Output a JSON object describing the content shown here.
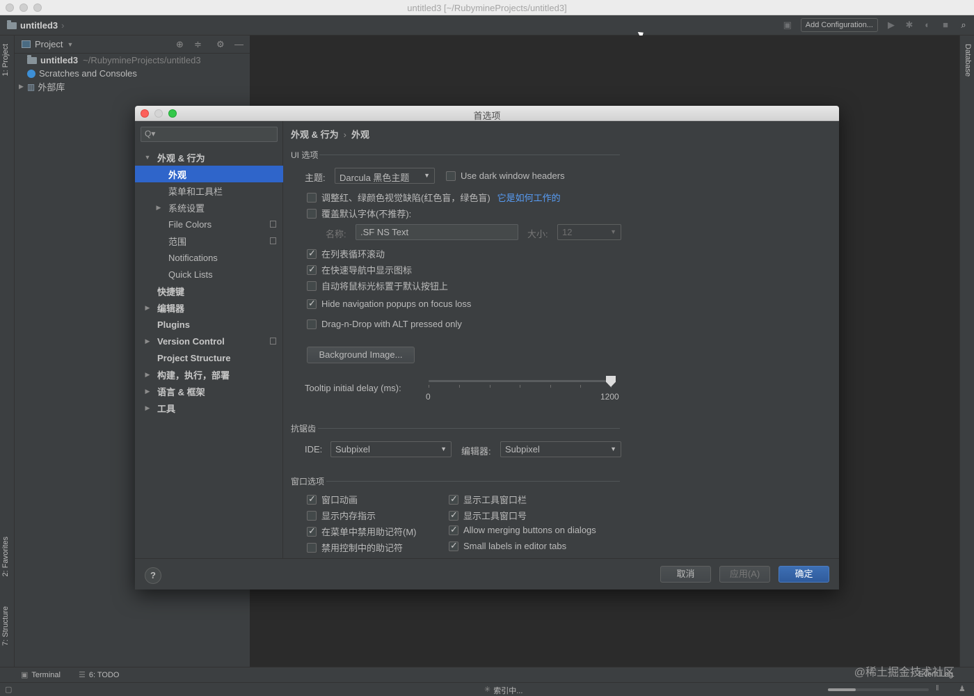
{
  "window": {
    "title": "untitled3 [~/RubymineProjects/untitled3]"
  },
  "navbar": {
    "project_name": "untitled3",
    "add_config_label": "Add Configuration..."
  },
  "tool_stripes": {
    "project_tab": "1: Project",
    "favorites_tab": "2: Favorites",
    "structure_tab": "7: Structure",
    "database_tab": "Database"
  },
  "project_panel": {
    "header": "Project",
    "tree": [
      {
        "label": "untitled3",
        "path": "~/RubymineProjects/untitled3"
      },
      {
        "label": "Scratches and Consoles"
      },
      {
        "label": "外部库"
      }
    ]
  },
  "bottom": {
    "terminal": "Terminal",
    "todo": "6: TODO",
    "event_log": "Event Log",
    "indexing": "索引中..."
  },
  "dialog": {
    "title": "首选项",
    "search_placeholder": "Q▾",
    "sidebar": [
      {
        "label": "外观 & 行为"
      },
      {
        "label": "外观"
      },
      {
        "label": "菜单和工具栏"
      },
      {
        "label": "系统设置"
      },
      {
        "label": "File Colors"
      },
      {
        "label": "范围"
      },
      {
        "label": "Notifications"
      },
      {
        "label": "Quick Lists"
      },
      {
        "label": "快捷键"
      },
      {
        "label": "编辑器"
      },
      {
        "label": "Plugins"
      },
      {
        "label": "Version Control"
      },
      {
        "label": "Project Structure"
      },
      {
        "label": "构建，执行，部署"
      },
      {
        "label": "语言 & 框架"
      },
      {
        "label": "工具"
      }
    ],
    "breadcrumb": {
      "parent": "外观 & 行为",
      "current": "外观"
    },
    "ui_options": {
      "section": "UI 选项",
      "theme_label": "主题:",
      "theme_value": "Darcula 黑色主题",
      "dark_headers": "Use dark window headers",
      "color_blind": "调整红、绿颜色视觉缺陷(红色盲，绿色盲)",
      "color_blind_link": "它是如何工作的",
      "override_font": "覆盖默认字体(不推荐):",
      "font_name_label": "名称:",
      "font_name_value": ".SF NS Text",
      "font_size_label": "大小:",
      "font_size_value": "12",
      "cyclic_scroll": "在列表循环滚动",
      "show_icons_nav": "在快速导航中显示图标",
      "move_mouse_default": "自动将鼠标光标置于默认按钮上",
      "hide_popups": "Hide navigation popups on focus loss",
      "drag_drop_alt": "Drag-n-Drop with ALT pressed only",
      "background_image": "Background Image...",
      "tooltip_label": "Tooltip initial delay (ms):",
      "tooltip_min": "0",
      "tooltip_max": "1200",
      "tooltip_value": 1200
    },
    "antialiasing": {
      "section": "抗锯齿",
      "ide_label": "IDE:",
      "ide_value": "Subpixel",
      "editor_label": "编辑器:",
      "editor_value": "Subpixel"
    },
    "window_options": {
      "section": "窗口选项",
      "animate": "窗口动画",
      "memory": "显示内存指示",
      "disable_mnemonics_menu": "在菜单中禁用助记符(M)",
      "disable_mnemonics_controls": "禁用控制中的助记符",
      "tool_window_bars": "显示工具窗口栏",
      "tool_window_numbers": "显示工具窗口号",
      "merging_buttons": "Allow merging buttons on dialogs",
      "small_labels": "Small labels in editor tabs"
    },
    "footer": {
      "help": "?",
      "cancel": "取消",
      "apply": "应用(A)",
      "ok": "确定"
    }
  },
  "corner_watermark": "@稀土掘金技术社区",
  "colors": {
    "selection": "#2f65ca",
    "primary_button": "#365f9f",
    "link": "#589df6",
    "close": "#fc605b",
    "minimize": "#d5d5d5",
    "zoom": "#34c84a"
  }
}
